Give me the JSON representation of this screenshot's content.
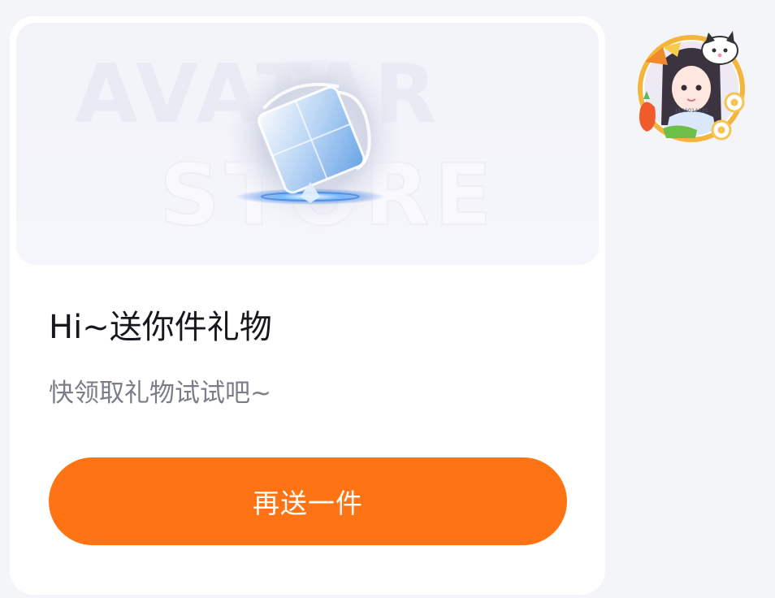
{
  "message": {
    "banner_watermark_line1": "AVATAR",
    "banner_watermark_line2": "STORE",
    "title": "Hi~送你件礼物",
    "subtitle": "快领取礼物试试吧~",
    "resend_button_label": "再送一件"
  },
  "avatar": {
    "icon": "gift-sender-avatar-icon",
    "id_text": "1536014135"
  },
  "colors": {
    "page_background": "#f4f5f8",
    "card_background": "#ffffff",
    "banner_background": "#f2f3f9",
    "title_text": "#16181d",
    "subtitle_text": "#7a7e88",
    "button_accent": "#fe7314",
    "button_text": "#ffffff",
    "frame_ring": "#f3b53c"
  }
}
